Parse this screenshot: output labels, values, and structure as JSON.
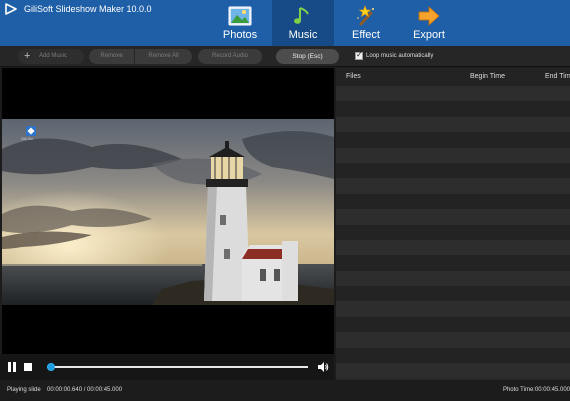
{
  "window": {
    "title": "GiliSoft Slideshow Maker 10.0.0",
    "logo_icon": "play-logo-icon"
  },
  "nav": {
    "tabs": [
      {
        "label": "Photos",
        "icon": "photos-icon",
        "active": false
      },
      {
        "label": "Music",
        "icon": "music-note-icon",
        "active": true
      },
      {
        "label": "Effect",
        "icon": "magic-wand-icon",
        "active": false
      },
      {
        "label": "Export",
        "icon": "export-arrow-icon",
        "active": false
      }
    ]
  },
  "toolbar": {
    "add_music": "Add Music",
    "remove": "Remove",
    "remove_all": "Remove All",
    "record_audio": "Record Audio",
    "stop": "Stop (Esc)",
    "loop_label": "Loop music automatically",
    "loop_checked": true
  },
  "preview": {
    "watermark_text": "Gili So"
  },
  "player": {
    "progress": 0.014
  },
  "status": {
    "label": "Playing slide",
    "time": "00:00:00.640 / 00:00:45.000",
    "photo_time": "Photo Time:00:00:45.000"
  },
  "music_list": {
    "columns": [
      "Files",
      "Begin Time",
      "End Time"
    ],
    "rows": []
  },
  "colors": {
    "accent": "#1f5fa8",
    "seek": "#1e9bdc"
  }
}
